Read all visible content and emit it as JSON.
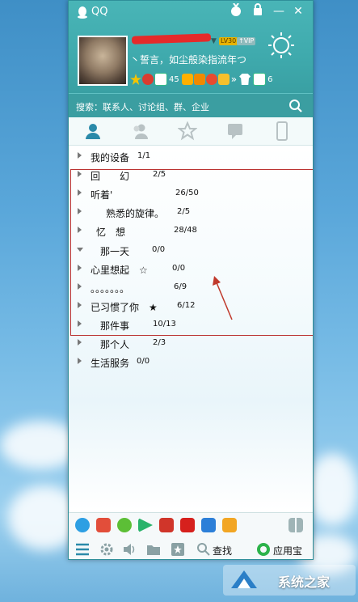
{
  "window": {
    "title": "QQ"
  },
  "profile": {
    "level_badge": "LV30",
    "vip_badge": "↑VIP",
    "signature": "丶誓言，如尘般染指流年つ",
    "mail_count": "45",
    "message_count": "6"
  },
  "search": {
    "placeholder": "搜索：联系人、讨论组、群、企业"
  },
  "groups": [
    {
      "name": "我的设备",
      "count": "1/1",
      "expanded": false
    },
    {
      "name": "回　　幻",
      "count": "2/5",
      "expanded": false
    },
    {
      "name": "听着'",
      "count": "26/50",
      "expanded": false
    },
    {
      "name": "　熟悉的旋律。",
      "count": "2/5",
      "expanded": false
    },
    {
      "name": "忆　想",
      "count": "28/48",
      "expanded": false
    },
    {
      "name": "那一天",
      "count": "0/0",
      "expanded": true
    },
    {
      "name": "心里想起　☆",
      "count": "0/0",
      "expanded": false
    },
    {
      "name": "。。。。。。。",
      "count": "6/9",
      "expanded": false
    },
    {
      "name": "已习惯了你　★",
      "count": "6/12",
      "expanded": false
    },
    {
      "name": "那件事",
      "count": "10/13",
      "expanded": false
    },
    {
      "name": "那个人",
      "count": "2/3",
      "expanded": false
    },
    {
      "name": "生活服务",
      "count": "0/0",
      "expanded": false
    }
  ],
  "bottom": {
    "find_label": "查找",
    "appstore_label": "应用宝"
  },
  "watermark": {
    "text": "系统之家"
  },
  "colors": {
    "accent": "#3faaad",
    "selection_border": "#b33333"
  }
}
